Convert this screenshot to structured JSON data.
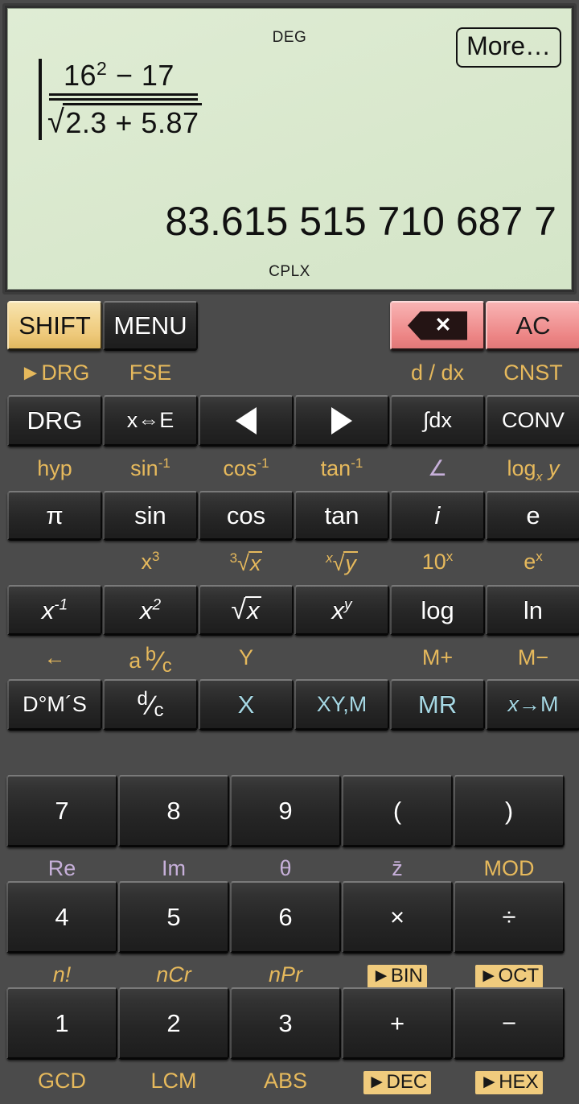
{
  "display": {
    "angle_mode": "DEG",
    "complex_mode": "CPLX",
    "more_button": "More…",
    "formula": {
      "numerator_base": "16",
      "numerator_exp": "2",
      "numerator_rest": " − 17",
      "denominator_radical": "√",
      "denominator_body": "2.3 + 5.87"
    },
    "result": "83.615 515 710 687 7"
  },
  "colors": {
    "lcd_background": "#dcead0",
    "shift_key": "#f3d692",
    "clear_key": "#f29a9a",
    "memory_text": "#a6d8e4",
    "shift_label": "#e6b95c",
    "alpha_label": "#c7b0da",
    "highlight_label_bg": "#f0cb7d",
    "key_face": "#2b2b2b",
    "body_background": "#4b4b4b"
  },
  "rows": [
    {
      "name": "row-control",
      "columns": 6,
      "keys": [
        {
          "id": "shift",
          "label": "SHIFT",
          "style": "shift"
        },
        {
          "id": "menu",
          "label": "MENU",
          "style": "dark"
        },
        {
          "id": "gap1",
          "label": "",
          "style": "none"
        },
        {
          "id": "gap2",
          "label": "",
          "style": "none"
        },
        {
          "id": "backspace",
          "label": "",
          "icon": "backspace-icon",
          "style": "red"
        },
        {
          "id": "ac",
          "label": "AC",
          "style": "red"
        }
      ],
      "shift_labels": [
        {
          "col": 1,
          "text": "►DRG",
          "color": "amber"
        },
        {
          "col": 2,
          "text": "FSE",
          "color": "amber"
        },
        {
          "col": 5,
          "text": "d / dx",
          "color": "amber"
        },
        {
          "col": 6,
          "text": "CNST",
          "color": "amber"
        }
      ]
    },
    {
      "name": "row-nav",
      "columns": 6,
      "keys": [
        {
          "id": "drg",
          "label": "DRG",
          "style": "dark"
        },
        {
          "id": "x-e",
          "label": "x⇔E",
          "style": "dark"
        },
        {
          "id": "left",
          "label": "",
          "icon": "arrow-left-icon",
          "style": "dark"
        },
        {
          "id": "right",
          "label": "",
          "icon": "arrow-right-icon",
          "style": "dark"
        },
        {
          "id": "integral",
          "label": "∫dx",
          "style": "dark"
        },
        {
          "id": "conv",
          "label": "CONV",
          "style": "dark"
        }
      ],
      "shift_labels": [
        {
          "col": 1,
          "text": "hyp",
          "color": "amber"
        },
        {
          "col": 2,
          "text": "sin",
          "sup": "-1",
          "color": "amber"
        },
        {
          "col": 3,
          "text": "cos",
          "sup": "-1",
          "color": "amber"
        },
        {
          "col": 4,
          "text": "tan",
          "sup": "-1",
          "color": "amber"
        },
        {
          "col": 5,
          "text": "∠",
          "color": "purple"
        },
        {
          "col": 6,
          "text": "log",
          "sub": "x",
          "tail": " y",
          "color": "amber"
        }
      ]
    },
    {
      "name": "row-trig",
      "columns": 6,
      "keys": [
        {
          "id": "pi",
          "label": "π",
          "style": "dark"
        },
        {
          "id": "sin",
          "label": "sin",
          "style": "dark"
        },
        {
          "id": "cos",
          "label": "cos",
          "style": "dark"
        },
        {
          "id": "tan",
          "label": "tan",
          "style": "dark"
        },
        {
          "id": "imaginary",
          "label": "i",
          "style": "dark"
        },
        {
          "id": "euler",
          "label": "e",
          "style": "dark"
        }
      ],
      "shift_labels": [
        {
          "col": 2,
          "text": "x",
          "sup": "3",
          "color": "amber"
        },
        {
          "col": 3,
          "text": "³√x",
          "color": "amber"
        },
        {
          "col": 4,
          "text": "ˣ√y",
          "color": "amber"
        },
        {
          "col": 5,
          "text": "10",
          "sup": "x",
          "color": "amber"
        },
        {
          "col": 6,
          "text": "e",
          "sup": "x",
          "color": "amber"
        }
      ]
    },
    {
      "name": "row-power",
      "columns": 6,
      "keys": [
        {
          "id": "inverse",
          "label": "x",
          "sup": "-1",
          "style": "dark"
        },
        {
          "id": "square",
          "label": "x",
          "sup": "2",
          "style": "dark"
        },
        {
          "id": "sqrt",
          "label": "√x",
          "style": "dark"
        },
        {
          "id": "power",
          "label": "x",
          "sup": "y",
          "style": "dark"
        },
        {
          "id": "log",
          "label": "log",
          "style": "dark"
        },
        {
          "id": "ln",
          "label": "ln",
          "style": "dark"
        }
      ],
      "shift_labels": [
        {
          "col": 1,
          "text": "←",
          "color": "amber"
        },
        {
          "col": 2,
          "text": "a b/c",
          "color": "amber"
        },
        {
          "col": 3,
          "text": "Y",
          "color": "amber"
        },
        {
          "col": 5,
          "text": "M+",
          "color": "amber"
        },
        {
          "col": 6,
          "text": "M−",
          "color": "amber"
        }
      ]
    },
    {
      "name": "row-memory",
      "columns": 6,
      "keys": [
        {
          "id": "dms",
          "label": "D°M´S",
          "style": "dark"
        },
        {
          "id": "dc",
          "label": "d/c",
          "style": "dark"
        },
        {
          "id": "mem-x",
          "label": "X",
          "style": "mem"
        },
        {
          "id": "mem-xym",
          "label": "XY,M",
          "style": "mem"
        },
        {
          "id": "mem-mr",
          "label": "MR",
          "style": "mem"
        },
        {
          "id": "mem-store",
          "label": "x→M",
          "style": "mem"
        }
      ],
      "shift_labels": []
    },
    {
      "name": "row-789",
      "columns": 5,
      "keys": [
        {
          "id": "num-7",
          "label": "7",
          "style": "dark"
        },
        {
          "id": "num-8",
          "label": "8",
          "style": "dark"
        },
        {
          "id": "num-9",
          "label": "9",
          "style": "dark"
        },
        {
          "id": "paren-open",
          "label": "(",
          "style": "dark"
        },
        {
          "id": "paren-close",
          "label": ")",
          "style": "dark"
        }
      ],
      "shift_labels": [
        {
          "col": 1,
          "text": "Re",
          "color": "purple"
        },
        {
          "col": 2,
          "text": "Im",
          "color": "purple"
        },
        {
          "col": 3,
          "text": "θ",
          "color": "purple"
        },
        {
          "col": 4,
          "text": "z̄",
          "color": "purple"
        },
        {
          "col": 5,
          "text": "MOD",
          "color": "amber"
        }
      ]
    },
    {
      "name": "row-456",
      "columns": 5,
      "keys": [
        {
          "id": "num-4",
          "label": "4",
          "style": "dark"
        },
        {
          "id": "num-5",
          "label": "5",
          "style": "dark"
        },
        {
          "id": "num-6",
          "label": "6",
          "style": "dark"
        },
        {
          "id": "multiply",
          "label": "×",
          "style": "dark"
        },
        {
          "id": "divide",
          "label": "÷",
          "style": "dark"
        }
      ],
      "shift_labels": [
        {
          "col": 1,
          "text": "n!",
          "color": "amber",
          "italic": true
        },
        {
          "col": 2,
          "text": "nCr",
          "color": "amber",
          "italic": true
        },
        {
          "col": 3,
          "text": "nPr",
          "color": "amber",
          "italic": true
        },
        {
          "col": 4,
          "text": "►BIN",
          "color": "amber",
          "highlight": true
        },
        {
          "col": 5,
          "text": "►OCT",
          "color": "amber",
          "highlight": true
        }
      ]
    },
    {
      "name": "row-123",
      "columns": 5,
      "keys": [
        {
          "id": "num-1",
          "label": "1",
          "style": "dark"
        },
        {
          "id": "num-2",
          "label": "2",
          "style": "dark"
        },
        {
          "id": "num-3",
          "label": "3",
          "style": "dark"
        },
        {
          "id": "plus",
          "label": "+",
          "style": "dark"
        },
        {
          "id": "minus",
          "label": "−",
          "style": "dark"
        }
      ],
      "shift_labels": [
        {
          "col": 1,
          "text": "GCD",
          "color": "amber"
        },
        {
          "col": 2,
          "text": "LCM",
          "color": "amber"
        },
        {
          "col": 3,
          "text": "ABS",
          "color": "amber"
        },
        {
          "col": 4,
          "text": "►DEC",
          "color": "amber",
          "highlight": true
        },
        {
          "col": 5,
          "text": "►HEX",
          "color": "amber",
          "highlight": true
        }
      ]
    }
  ]
}
